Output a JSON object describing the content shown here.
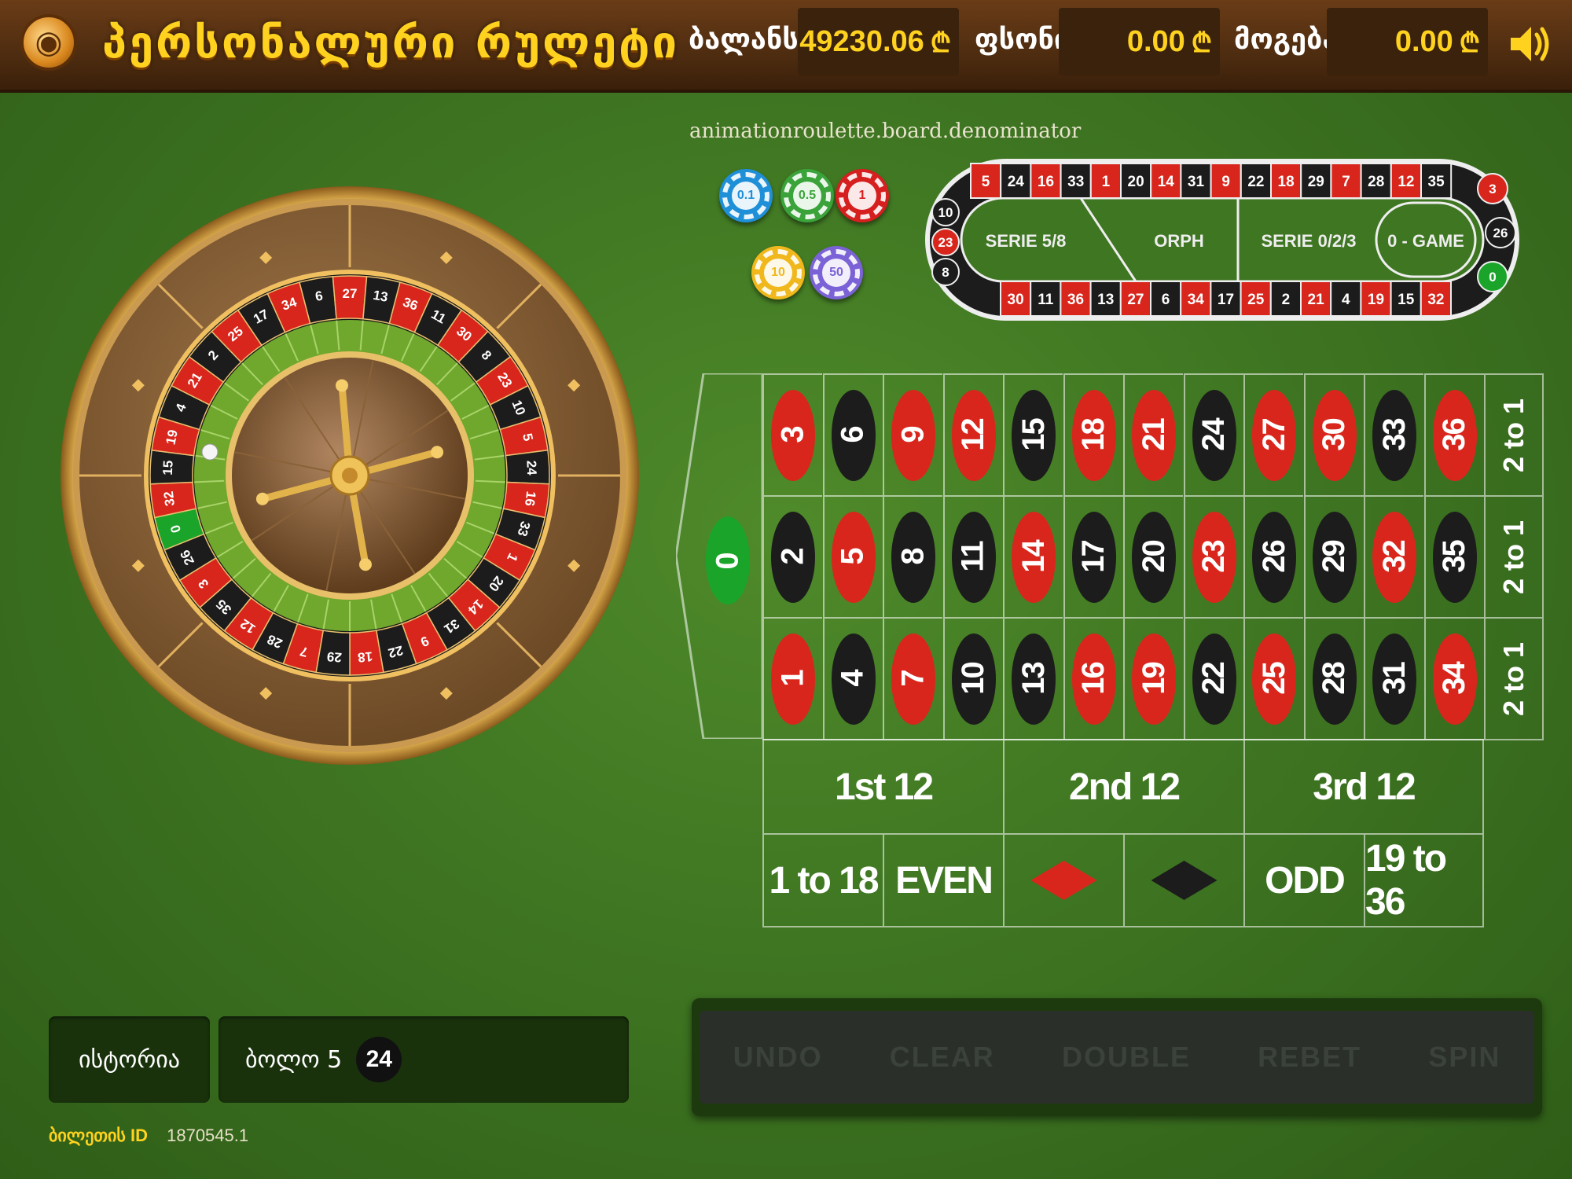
{
  "header": {
    "title": "პერსონალური რულეტი",
    "balance_label": "ბალანსი",
    "balance_value": "49230.06",
    "bet_label": "ფსონი",
    "bet_value": "0.00",
    "win_label": "მოგება",
    "win_value": "0.00",
    "currency": "₾"
  },
  "denominator_label": "animationroulette.board.denominator",
  "chips": [
    {
      "label": "0.1",
      "color": "#1f8fd8"
    },
    {
      "label": "0.5",
      "color": "#3aa33a"
    },
    {
      "label": "1",
      "color": "#d61f1f"
    },
    {
      "label": "10",
      "color": "#f0b81c"
    },
    {
      "label": "50",
      "color": "#7b62d6"
    }
  ],
  "racetrack": {
    "top_row": [
      "5",
      "24",
      "16",
      "33",
      "1",
      "20",
      "14",
      "31",
      "9",
      "22",
      "18",
      "29",
      "7",
      "28",
      "12",
      "35"
    ],
    "bottom_row": [
      "30",
      "11",
      "36",
      "13",
      "27",
      "6",
      "34",
      "17",
      "25",
      "2",
      "21",
      "4",
      "19",
      "15",
      "32"
    ],
    "left_end": [
      "10",
      "23",
      "8"
    ],
    "right_end": [
      "3",
      "26",
      "0"
    ],
    "sections": [
      "SERIE 5/8",
      "ORPH",
      "SERIE 0/2/3",
      "0 - GAME"
    ]
  },
  "wheel": {
    "numbers": [
      "0",
      "32",
      "15",
      "19",
      "4",
      "21",
      "2",
      "25",
      "17",
      "34",
      "6",
      "27",
      "13",
      "36",
      "11",
      "30",
      "8",
      "23",
      "10",
      "5",
      "24",
      "16",
      "33",
      "1",
      "20",
      "14",
      "31",
      "9",
      "22",
      "18",
      "29",
      "7",
      "28",
      "12",
      "35",
      "3",
      "26"
    ]
  },
  "board": {
    "zero": "0",
    "rows": [
      [
        "3",
        "6",
        "9",
        "12",
        "15",
        "18",
        "21",
        "24",
        "27",
        "30",
        "33",
        "36"
      ],
      [
        "2",
        "5",
        "8",
        "11",
        "14",
        "17",
        "20",
        "23",
        "26",
        "29",
        "32",
        "35"
      ],
      [
        "1",
        "4",
        "7",
        "10",
        "13",
        "16",
        "19",
        "22",
        "25",
        "28",
        "31",
        "34"
      ]
    ],
    "red_numbers": [
      "1",
      "3",
      "5",
      "7",
      "9",
      "12",
      "14",
      "16",
      "18",
      "19",
      "21",
      "23",
      "25",
      "27",
      "30",
      "32",
      "34",
      "36"
    ],
    "column_bets": [
      "2 to 1",
      "2 to 1",
      "2 to 1"
    ],
    "dozens": [
      "1st 12",
      "2nd 12",
      "3rd 12"
    ],
    "outside": [
      "1 to 18",
      "EVEN",
      "",
      "",
      "ODD",
      "19 to 36"
    ]
  },
  "colors": {
    "red": "#d9261c",
    "black": "#1c1c1c",
    "green": "#1aa52a",
    "felt": "#3f7622",
    "gold": "#ffd21f"
  },
  "history_label": "ისტორია",
  "last5_label": "ბოლო 5",
  "last_numbers": [
    "24"
  ],
  "controls": [
    "UNDO",
    "CLEAR",
    "DOUBLE",
    "REBET",
    "SPIN"
  ],
  "ticket": {
    "label": "ბილეთის ID",
    "value": "1870545.1"
  },
  "icons": {
    "logo": "roulette-logo-icon",
    "sound": "speaker-icon"
  }
}
